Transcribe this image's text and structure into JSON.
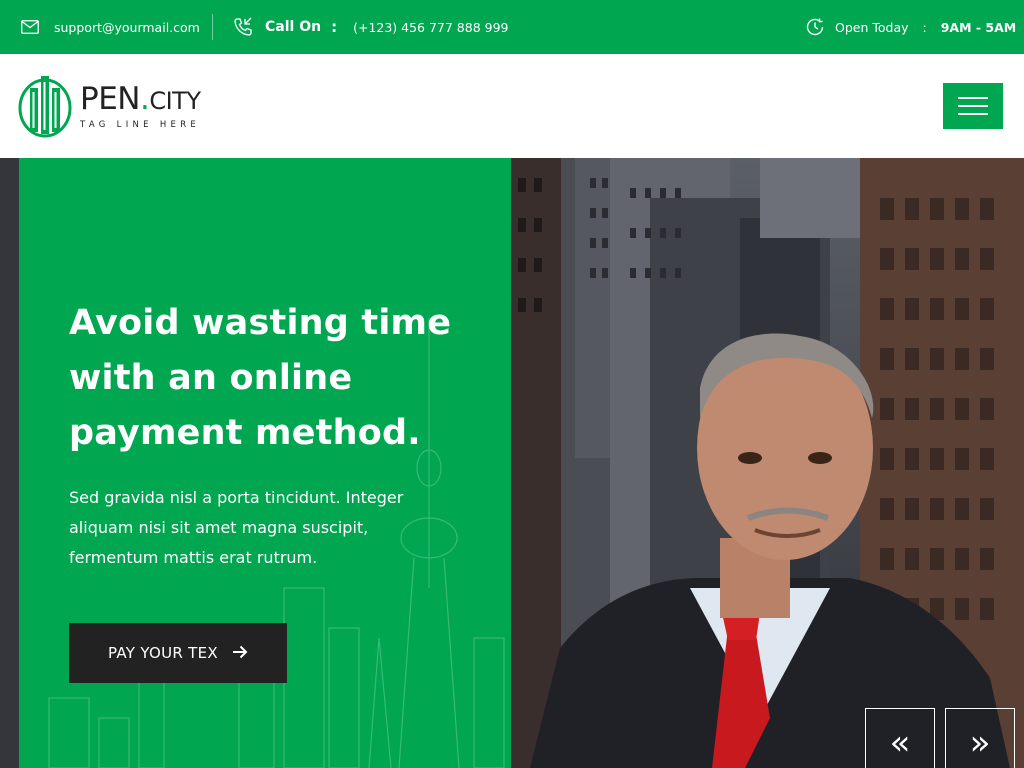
{
  "topbar": {
    "email": "support@yourmail.com",
    "call_label": "Call On",
    "call_colon": ":",
    "phone": "(+123) 456 777 888 999",
    "open_label": "Open Today",
    "open_colon": ":",
    "hours": "9AM - 5AM"
  },
  "header": {
    "logo_name": "PEN",
    "logo_dot": ".",
    "logo_city": "CITY",
    "logo_tagline": "TAG LINE HERE"
  },
  "hero": {
    "title": "Avoid wasting time with an online payment method.",
    "description": "Sed gravida nisl a porta tincidunt. Integer aliquam nisi sit amet magna suscipit, fermentum mattis erat rutrum.",
    "cta_label": "PAY YOUR TEX",
    "prev_icon": "«",
    "next_icon": "»"
  },
  "colors": {
    "brand_green": "#00a650",
    "dark": "#222222",
    "white": "#ffffff"
  },
  "icons": {
    "mail": "envelope-icon",
    "phone": "phone-icon",
    "clock": "clock-icon",
    "menu": "hamburger-icon",
    "arrow": "arrow-right-icon"
  }
}
